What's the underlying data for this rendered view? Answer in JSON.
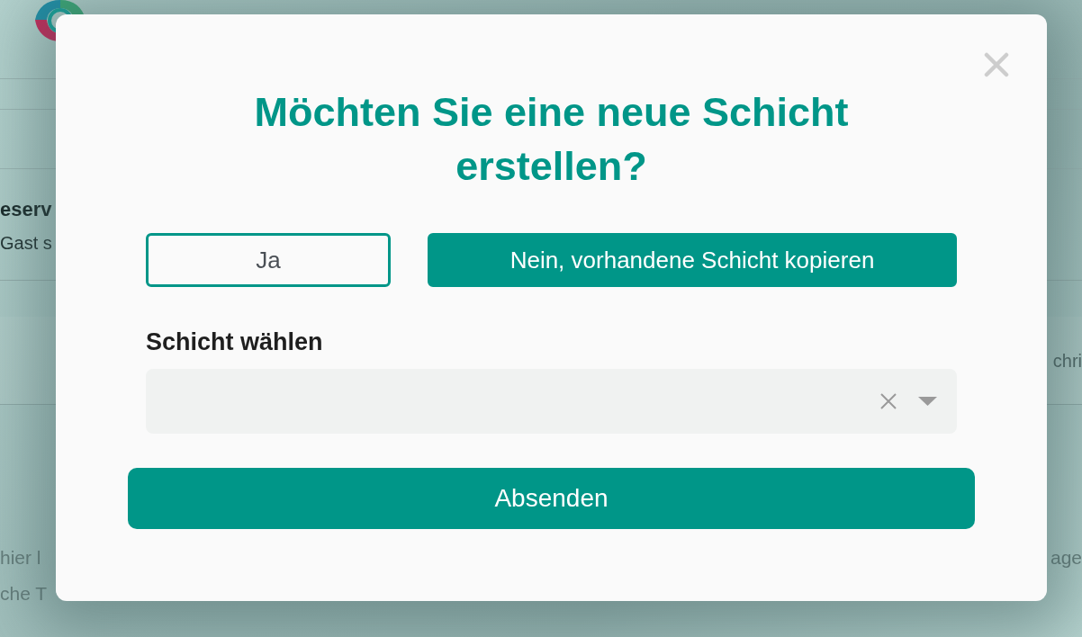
{
  "background_page": {
    "card": {
      "title": "eserv",
      "subtitle": "Gast s"
    },
    "row_text": "chri",
    "description": {
      "line_1": [
        "hier l",
        "age"
      ],
      "line_2": "che T"
    }
  },
  "dialog": {
    "title": "Möchten Sie eine neue Schicht erstellen?",
    "choices": [
      {
        "label": "Ja",
        "selected": false
      },
      {
        "label": "Nein, vorhandene Schicht kopieren",
        "selected": true
      }
    ],
    "shift_select": {
      "label": "Schicht wählen"
    },
    "submit_button": "Absenden"
  }
}
